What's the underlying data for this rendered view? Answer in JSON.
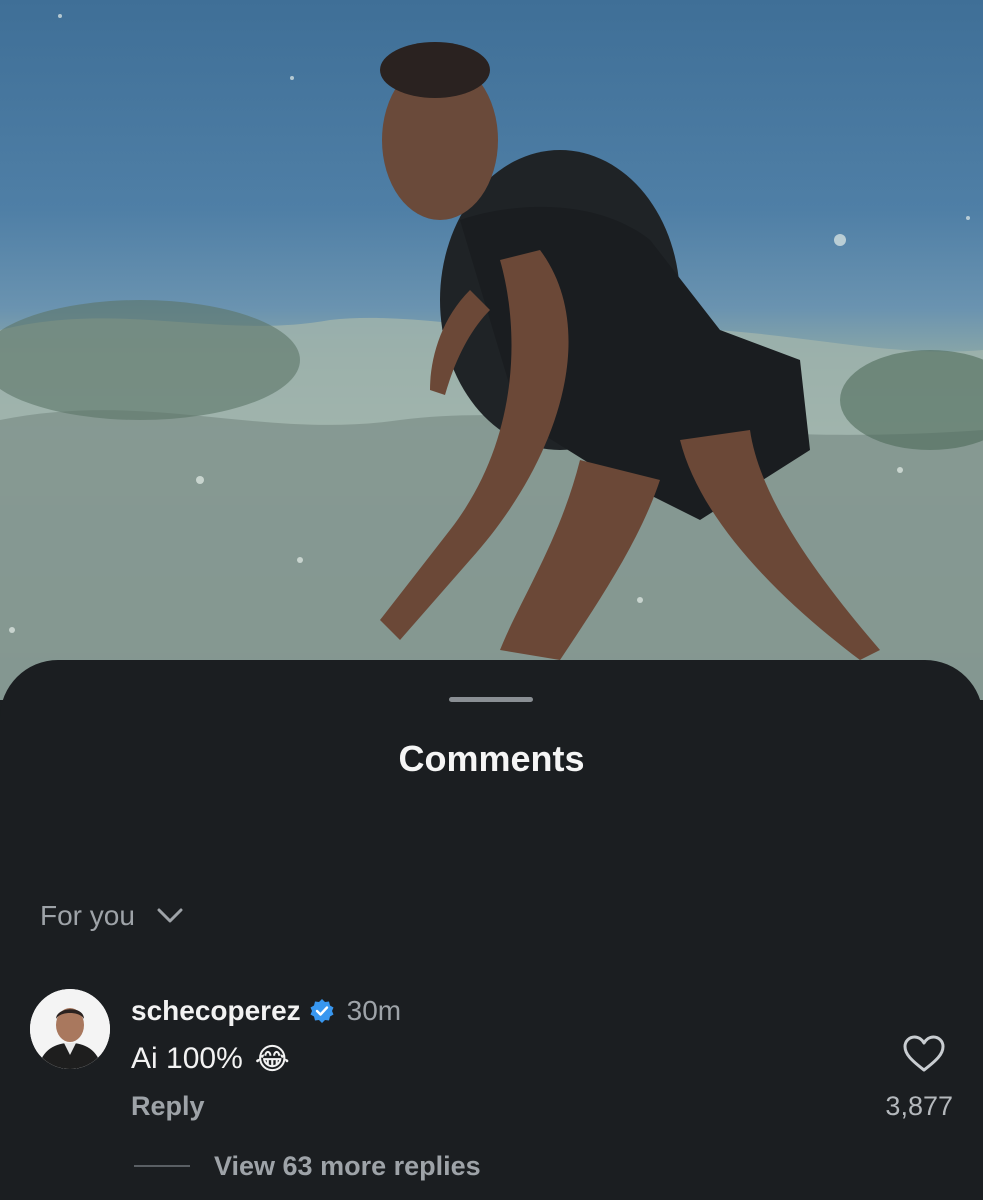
{
  "media": {
    "description_icon": "surfer-photo"
  },
  "sheet": {
    "title": "Comments",
    "filter": {
      "label": "For you",
      "icon": "chevron-down-icon"
    }
  },
  "comment": {
    "username": "schecoperez",
    "verified_icon": "verified-badge-icon",
    "time": "30m",
    "text": "Ai 100%",
    "emoji": "😂",
    "reply_label": "Reply",
    "like_icon": "heart-icon",
    "like_count": "3,877",
    "view_replies": "View 63 more replies"
  },
  "colors": {
    "sheet_bg": "#1b1e21",
    "verified_blue": "#3897f0",
    "secondary_text": "#9ea3a8"
  }
}
